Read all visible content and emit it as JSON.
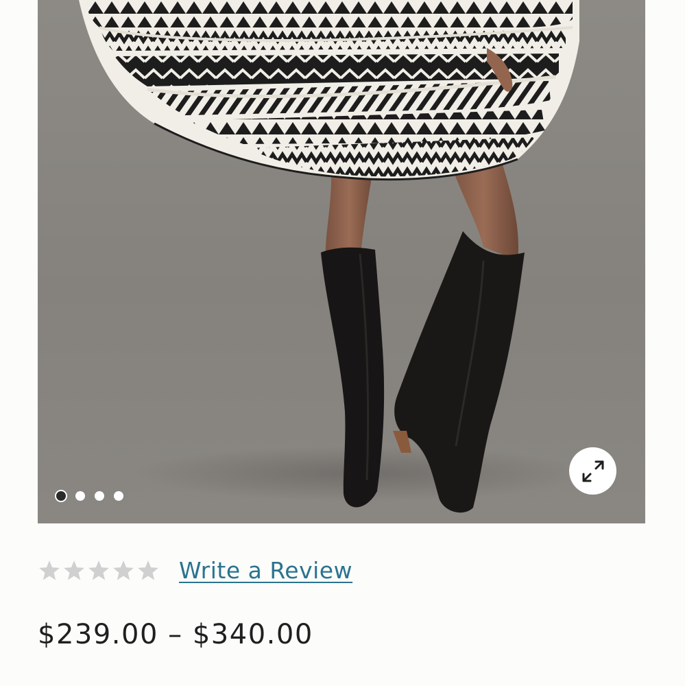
{
  "product": {
    "image_alt": "Model wearing black-and-white geometric tiered dress with tall black suede knee-high boots",
    "gallery": {
      "total_images": 4,
      "active_index": 0,
      "expand_icon": "expand-arrows-icon"
    },
    "rating": {
      "value": 0,
      "max": 5,
      "star_icon": "star-icon",
      "write_review_label": "Write a Review"
    },
    "price": {
      "low": "$239.00",
      "separator": "–",
      "high": "$340.00"
    }
  },
  "colors": {
    "link": "#2a7390",
    "star_empty": "#d0d0d0",
    "price_text": "#1f1f1f"
  }
}
